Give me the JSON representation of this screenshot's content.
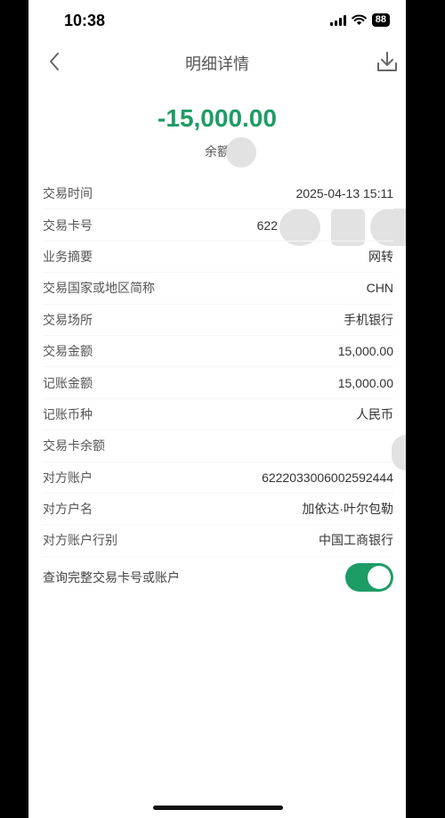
{
  "status_bar": {
    "time": "10:38",
    "battery": "88"
  },
  "nav": {
    "title": "明细详情"
  },
  "summary": {
    "amount": "-15,000.00",
    "balance_label": "余额"
  },
  "details": [
    {
      "label": "交易时间",
      "value": "2025-04-13 15:11"
    },
    {
      "label": "交易卡号",
      "value": "622"
    },
    {
      "label": "业务摘要",
      "value": "网转"
    },
    {
      "label": "交易国家或地区简称",
      "value": "CHN"
    },
    {
      "label": "交易场所",
      "value": "手机银行"
    },
    {
      "label": "交易金额",
      "value": "15,000.00"
    },
    {
      "label": "记账金额",
      "value": "15,000.00"
    },
    {
      "label": "记账币种",
      "value": "人民币"
    },
    {
      "label": "交易卡余额",
      "value": ""
    },
    {
      "label": "对方账户",
      "value": "6222033006002592444"
    },
    {
      "label": "对方户名",
      "value": "加依达·叶尔包勒"
    },
    {
      "label": "对方账户行别",
      "value": "中国工商银行"
    }
  ],
  "toggle": {
    "label": "查询完整交易卡号或账户",
    "on": true
  },
  "colors": {
    "accent": "#1e9c66"
  }
}
